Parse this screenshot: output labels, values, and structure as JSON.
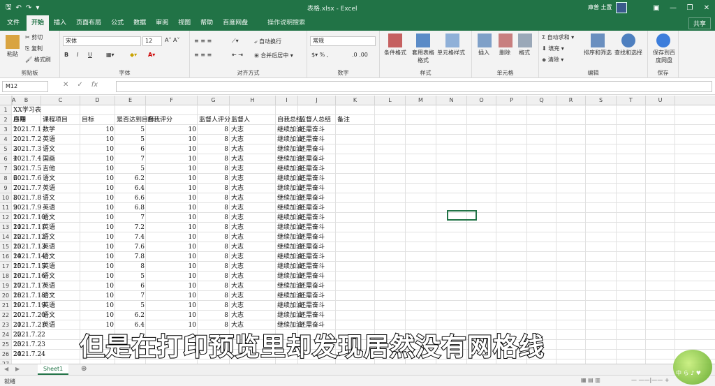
{
  "window": {
    "title": "表格.xlsx - Excel",
    "user": "庫普 土置",
    "share": "共享"
  },
  "tabs": [
    "文件",
    "开始",
    "插入",
    "页面布局",
    "公式",
    "数据",
    "审阅",
    "视图",
    "帮助",
    "百度网盘",
    "操作说明搜索"
  ],
  "ribbon": {
    "clipboard": {
      "label": "剪贴板",
      "paste": "粘贴",
      "cut": "剪切",
      "copy": "复制",
      "painter": "格式刷"
    },
    "font": {
      "label": "字体",
      "name": "宋体",
      "size": "12",
      "bold": "B",
      "italic": "I",
      "underline": "U"
    },
    "align": {
      "label": "对齐方式",
      "wrap": "自动换行",
      "merge": "合并后居中"
    },
    "number": {
      "label": "数字",
      "format": "常规"
    },
    "styles": {
      "label": "样式",
      "conditional": "条件格式",
      "table": "套用表格格式",
      "cell": "单元格样式"
    },
    "cells": {
      "label": "单元格",
      "insert": "插入",
      "delete": "删除",
      "format": "格式"
    },
    "editing": {
      "label": "编辑",
      "autosum": "自动求和",
      "fill": "填充",
      "clear": "清除",
      "sort": "排序和筛选",
      "find": "查找和选择"
    },
    "save": {
      "label": "保存",
      "btn": "保存到百度网盘"
    }
  },
  "formula": {
    "namebox": "M12",
    "fx": "fx"
  },
  "columns": [
    "A",
    "B",
    "C",
    "D",
    "E",
    "F",
    "G",
    "H",
    "I",
    "J",
    "K",
    "L",
    "M",
    "N",
    "O",
    "P",
    "Q",
    "R",
    "S",
    "T",
    "U"
  ],
  "sheet": {
    "title": "XX学习表",
    "headers": [
      "序号",
      "日期",
      "课程项目",
      "目标",
      "是否达到目标",
      "自我评分",
      "监督人评分",
      "监督人",
      "自我总结",
      "监督人总结",
      "备注"
    ],
    "rows": [
      [
        "1",
        "2021.7.1",
        "数学",
        "10",
        "5",
        "10",
        "8",
        "大志",
        "继续加油",
        "还需奋斗"
      ],
      [
        "2",
        "2021.7.2",
        "英语",
        "10",
        "5",
        "10",
        "8",
        "大志",
        "继续加油",
        "还需奋斗"
      ],
      [
        "3",
        "2021.7.3",
        "语文",
        "10",
        "6",
        "10",
        "8",
        "大志",
        "继续加油",
        "还需奋斗"
      ],
      [
        "4",
        "2021.7.4",
        "国画",
        "10",
        "7",
        "10",
        "8",
        "大志",
        "继续加油",
        "还需奋斗"
      ],
      [
        "5",
        "2021.7.5",
        "吉他",
        "10",
        "5",
        "10",
        "8",
        "大志",
        "继续加油",
        "还需奋斗"
      ],
      [
        "6",
        "2021.7.6",
        "语文",
        "10",
        "6.2",
        "10",
        "8",
        "大志",
        "继续加油",
        "还需奋斗"
      ],
      [
        "7",
        "2021.7.7",
        "英语",
        "10",
        "6.4",
        "10",
        "8",
        "大志",
        "继续加油",
        "还需奋斗"
      ],
      [
        "8",
        "2021.7.8",
        "语文",
        "10",
        "6.6",
        "10",
        "8",
        "大志",
        "继续加油",
        "还需奋斗"
      ],
      [
        "9",
        "2021.7.9",
        "英语",
        "10",
        "6.8",
        "10",
        "8",
        "大志",
        "继续加油",
        "还需奋斗"
      ],
      [
        "10",
        "2021.7.10",
        "语文",
        "10",
        "7",
        "10",
        "8",
        "大志",
        "继续加油",
        "还需奋斗"
      ],
      [
        "11",
        "2021.7.11",
        "英语",
        "10",
        "7.2",
        "10",
        "8",
        "大志",
        "继续加油",
        "还需奋斗"
      ],
      [
        "12",
        "2021.7.12",
        "语文",
        "10",
        "7.4",
        "10",
        "8",
        "大志",
        "继续加油",
        "还需奋斗"
      ],
      [
        "13",
        "2021.7.13",
        "英语",
        "10",
        "7.6",
        "10",
        "8",
        "大志",
        "继续加油",
        "还需奋斗"
      ],
      [
        "14",
        "2021.7.14",
        "语文",
        "10",
        "7.8",
        "10",
        "8",
        "大志",
        "继续加油",
        "还需奋斗"
      ],
      [
        "15",
        "2021.7.15",
        "英语",
        "10",
        "8",
        "10",
        "8",
        "大志",
        "继续加油",
        "还需奋斗"
      ],
      [
        "16",
        "2021.7.16",
        "语文",
        "10",
        "5",
        "10",
        "8",
        "大志",
        "继续加油",
        "还需奋斗"
      ],
      [
        "17",
        "2021.7.17",
        "英语",
        "10",
        "6",
        "10",
        "8",
        "大志",
        "继续加油",
        "还需奋斗"
      ],
      [
        "18",
        "2021.7.18",
        "语文",
        "10",
        "7",
        "10",
        "8",
        "大志",
        "继续加油",
        "还需奋斗"
      ],
      [
        "19",
        "2021.7.19",
        "英语",
        "10",
        "5",
        "10",
        "8",
        "大志",
        "继续加油",
        "还需奋斗"
      ],
      [
        "20",
        "2021.7.20",
        "语文",
        "10",
        "6.2",
        "10",
        "8",
        "大志",
        "继续加油",
        "还需奋斗"
      ],
      [
        "21",
        "2021.7.21",
        "英语",
        "10",
        "6.4",
        "10",
        "8",
        "大志",
        "继续加油",
        "还需奋斗"
      ],
      [
        "22",
        "2021.7.22",
        "",
        "",
        "",
        "",
        "",
        "",
        "",
        ""
      ],
      [
        "23",
        "2021.7.23",
        "",
        "",
        "",
        "",
        "",
        "",
        "",
        ""
      ],
      [
        "24",
        "2021.7.24",
        "",
        "",
        "",
        "",
        "",
        "",
        "",
        ""
      ]
    ]
  },
  "subtitle": "但是在打印预览里却发现居然没有网格线",
  "sheettab": "Sheet1",
  "status": "就绪",
  "watermark": "中 ら ♪ ♥"
}
